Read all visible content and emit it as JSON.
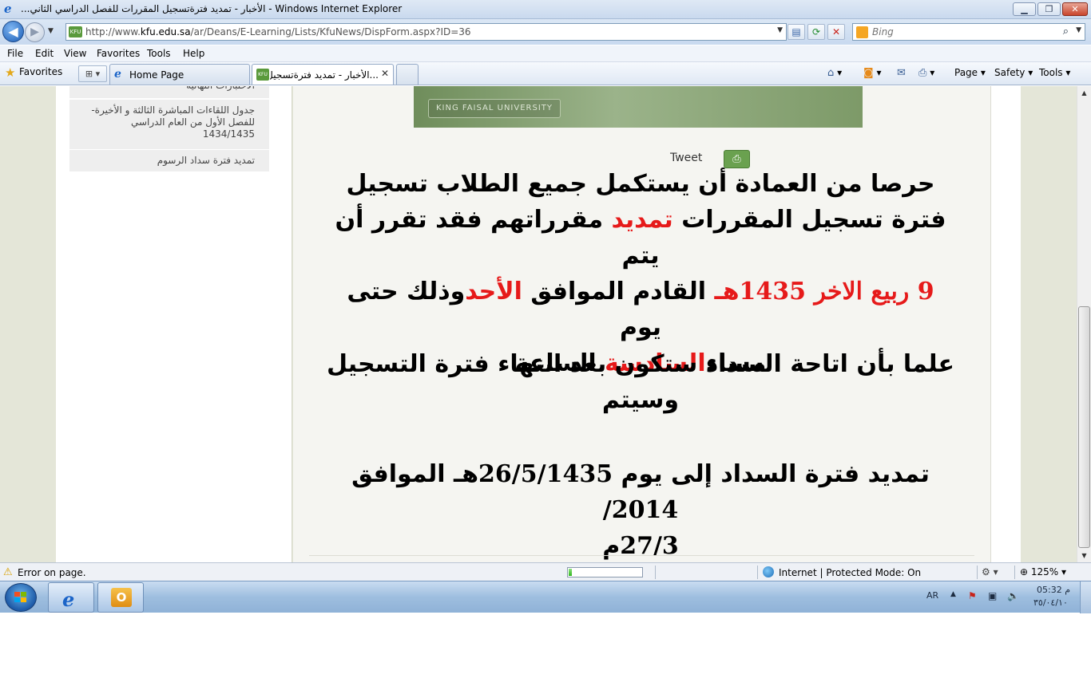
{
  "window": {
    "title": "...الأخبار - تمديد فترةتسجيل المقررات للفصل الدراسي الثاني - Windows Internet Explorer",
    "min_label": "▁",
    "max_label": "❐",
    "close_label": "✕"
  },
  "address_bar": {
    "url_prefix": "http://www.",
    "url_domain": "kfu.edu.sa",
    "url_path": "/ar/Deans/E-Learning/Lists/KfuNews/DispForm.aspx?ID=36",
    "site_icon_label": "KFU",
    "search_placeholder": "Bing"
  },
  "menu": [
    "File",
    "Edit",
    "View",
    "Favorites",
    "Tools",
    "Help"
  ],
  "favorites_bar": {
    "favorites_label": "Favorites",
    "tabs": [
      {
        "label": "Home Page"
      },
      {
        "label": "...الأخبار - تمديد فترةتسجيل"
      }
    ],
    "commands": [
      "Page",
      "Safety",
      "Tools"
    ]
  },
  "sidebar": {
    "links": [
      {
        "label": "الاختبارات النهائية"
      },
      {
        "label": "جدول اللقاءات المباشرة الثالثة و الأخيرة- للفصل الأول من العام الدراسي 1434/1435"
      },
      {
        "label": "تمديد فترة سداد الرسوم"
      }
    ]
  },
  "content": {
    "banner_text": "KING FAISAL UNIVERSITY",
    "tweet_label": "Tweet",
    "para1": {
      "l1": "حرصا من العمادة أن يستكمل جميع الطلاب تسجيل",
      "l2a": "فترة تسجيل المقررات ",
      "l2b": "تمديد",
      "l2c": " مقرراتهم فقد تقرر أن يتم",
      "l3a": "9 ربيع الاخر 1435",
      "l3b": "هـ",
      "l3c": " القادم الموافق  ",
      "l3d": "الأحد",
      "l3e": "وذلك حتى يوم",
      "l4a": "مساء",
      "l4b": "السادسة",
      "l4c": " الساعة"
    },
    "para2": {
      "l1": "علما بأن اتاحة السداد ستكون بعد انتهاء فترة التسجيل",
      "l2": "وسيتم"
    },
    "para3": {
      "l1a": "تمديد فترة السداد إلى يوم ",
      "l1b": "26/5/1435",
      "l1c": "هـ الموافق ",
      "l1d": "2014/",
      "l2a": "27/3",
      "l2b": "م"
    }
  },
  "status_bar": {
    "text": "Error on page.",
    "progress": 0.04,
    "zone": "Internet | Protected Mode: On",
    "zoom": "125%"
  },
  "taskbar": {
    "language": "AR",
    "time": "م 05:32",
    "date": "٣٥/٠٤/١٠"
  }
}
